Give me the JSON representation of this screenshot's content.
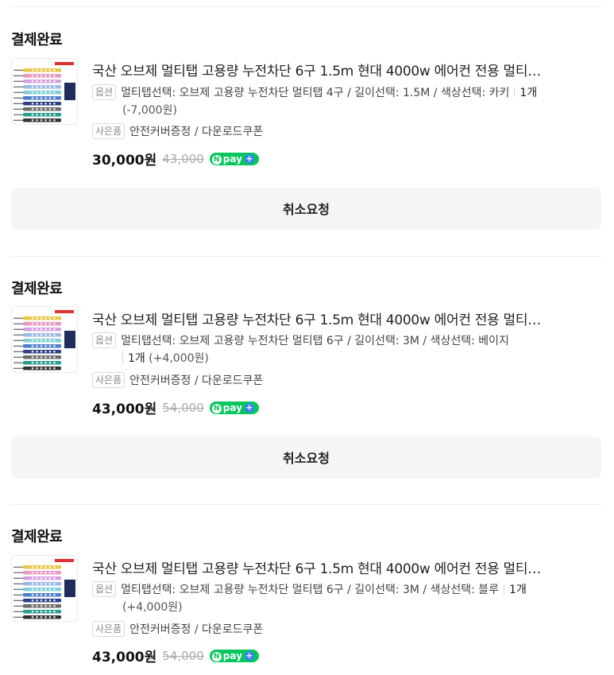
{
  "orders": [
    {
      "status": "결제완료",
      "product_title": "국산 오브제 멀티탭 고용량 누전차단 6구 1.5m 현대 4000w 에어컨 전용 멀티…",
      "option_tag": "옵션",
      "option_text_line1": "멀티탭선택: 오브제 고용량 누전차단 멀티탭 4구 / 길이선택: 1.5M / 색상선택: 카키",
      "quantity": "1개",
      "option_extra_price": "(-7,000원)",
      "gift_tag": "사은품",
      "gift_text": "안전커버증정 / 다운로드쿠폰",
      "price": "30,000원",
      "original_price": "43,000",
      "pay_badge": "pay",
      "cancel_label": "취소요청"
    },
    {
      "status": "결제완료",
      "product_title": "국산 오브제 멀티탭 고용량 누전차단 6구 1.5m 현대 4000w 에어컨 전용 멀티…",
      "option_tag": "옵션",
      "option_text_line1": "멀티탭선택: 오브제 고용량 누전차단 멀티탭 6구 / 길이선택: 3M / 색상선택: 베이지",
      "quantity": "1개",
      "option_extra_price": "(+4,000원)",
      "gift_tag": "사은품",
      "gift_text": "안전커버증정 / 다운로드쿠폰",
      "price": "43,000원",
      "original_price": "54,000",
      "pay_badge": "pay",
      "cancel_label": "취소요청"
    },
    {
      "status": "결제완료",
      "product_title": "국산 오브제 멀티탭 고용량 누전차단 6구 1.5m 현대 4000w 에어컨 전용 멀티…",
      "option_tag": "옵션",
      "option_text_line1": "멀티탭선택: 오브제 고용량 누전차단 멀티탭 6구 / 길이선택: 3M / 색상선택: 블루",
      "quantity": "1개",
      "option_extra_price": "(+4,000원)",
      "gift_tag": "사은품",
      "gift_text": "안전커버증정 / 다운로드쿠폰",
      "price": "43,000원",
      "original_price": "54,000",
      "pay_badge": "pay"
    }
  ],
  "icons": {
    "thumbnail": "power-strip-product-image",
    "npay": "naver-pay-plus-icon"
  },
  "colors": {
    "npay_green": "#03c75a",
    "npay_plus_blue": "#3b82f6",
    "strike_gray": "#aaaaaa",
    "button_bg": "#f5f5f5"
  }
}
